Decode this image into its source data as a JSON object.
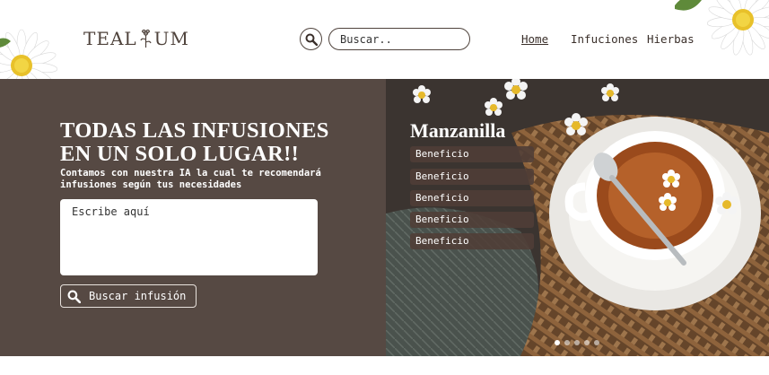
{
  "brand": {
    "logo_left": "TEAL",
    "logo_right": "UM",
    "logo_mark": "flower-icon"
  },
  "header": {
    "search_icon": "search-icon",
    "search_placeholder": "Buscar..",
    "nav": [
      {
        "label": "Home",
        "active": true
      },
      {
        "label": "Infuciones",
        "active": false
      },
      {
        "label": "Hierbas",
        "active": false
      }
    ]
  },
  "hero": {
    "title": "TODAS LAS INFUSIONES EN UN SOLO LUGAR!!",
    "subtitle": "Contamos con nuestra IA la cual te recomendará infusiones según tus necesidades",
    "textarea_placeholder": "Escribe aquí",
    "button_label": "Buscar infusión",
    "button_icon": "search-icon"
  },
  "featured": {
    "name": "Manzanilla",
    "benefits": [
      "Beneficio",
      "Beneficio",
      "Beneficio",
      "Beneficio",
      "Beneficio"
    ],
    "carousel_total": 5,
    "carousel_active": 1
  },
  "colors": {
    "brand_brown": "#564943",
    "text_dark": "#4f433c",
    "white": "#ffffff"
  }
}
